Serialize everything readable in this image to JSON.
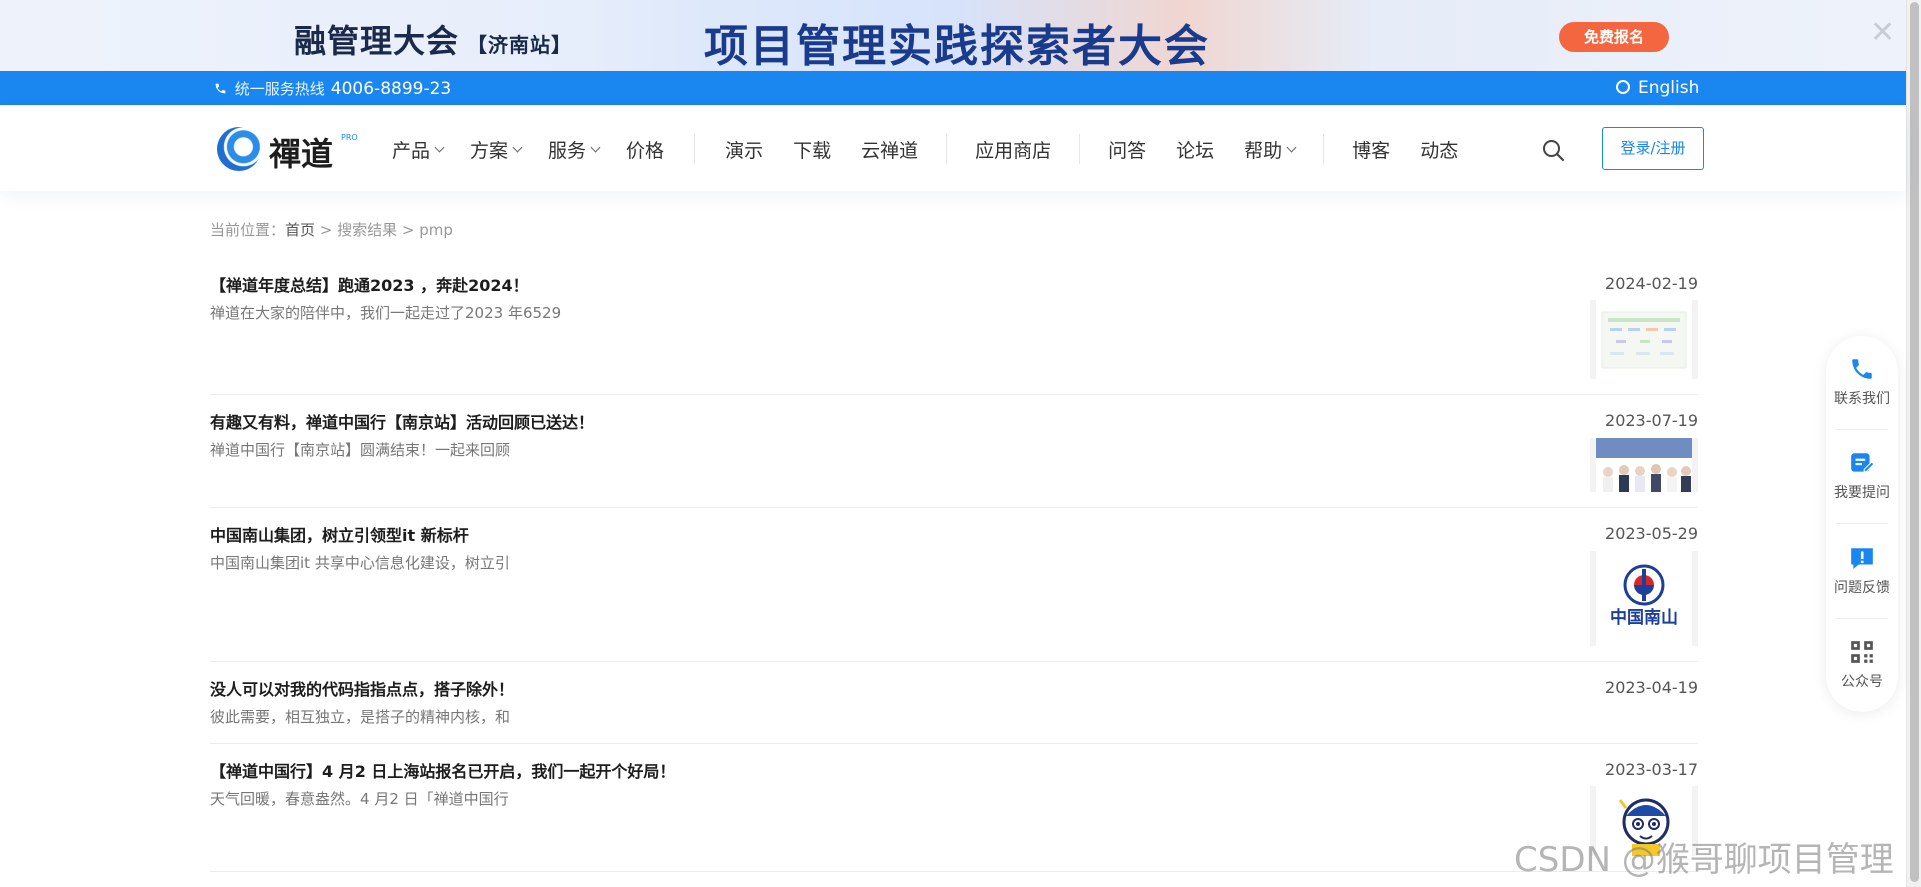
{
  "banner": {
    "left_title": "融管理大会",
    "left_tag": "【济南站】",
    "main_title": "项目管理实践探索者大会",
    "signup_label": "免费报名",
    "close_glyph": "✕"
  },
  "topbar": {
    "hotline_label": "统一服务热线",
    "hotline_number": "4006-8899-23",
    "language": "English"
  },
  "nav": {
    "logo_text": "禪道",
    "logo_tm": "PRO",
    "menu": [
      {
        "label": "产品",
        "dropdown": true
      },
      {
        "label": "方案",
        "dropdown": true
      },
      {
        "label": "服务",
        "dropdown": true
      },
      {
        "label": "价格",
        "dropdown": false
      },
      {
        "label": "演示",
        "dropdown": false
      },
      {
        "label": "下载",
        "dropdown": false
      },
      {
        "label": "云禅道",
        "dropdown": false
      },
      {
        "label": "应用商店",
        "dropdown": false
      },
      {
        "label": "问答",
        "dropdown": false
      },
      {
        "label": "论坛",
        "dropdown": false
      },
      {
        "label": "帮助",
        "dropdown": true
      },
      {
        "label": "博客",
        "dropdown": false
      },
      {
        "label": "动态",
        "dropdown": false
      }
    ],
    "login_label": "登录/注册"
  },
  "breadcrumb": {
    "prefix": "当前位置：",
    "home": "首页",
    "sep1": " > ",
    "search": "搜索结果",
    "sep2": " > ",
    "query": "pmp"
  },
  "results": [
    {
      "title": "【禅道年度总结】跑通2023 ，奔赴2024！",
      "desc": "禅道在大家的陪伴中，我们一起走过了2023 年6529",
      "date": "2024-02-19",
      "thumb": "chart"
    },
    {
      "title": "有趣又有料，禅道中国行【南京站】活动回顾已送达！",
      "desc": "禅道中国行【南京站】圆满结束！一起来回顾",
      "date": "2023-07-19",
      "thumb": "photo"
    },
    {
      "title": "中国南山集团，树立引领型it 新标杆",
      "desc": "中国南山集团it 共享中心信息化建设，树立引",
      "date": "2023-05-29",
      "thumb": "logo",
      "thumb_text": "中国南山"
    },
    {
      "title": "没人可以对我的代码指指点点，搭子除外！",
      "desc": "彼此需要，相互独立，是搭子的精神内核，和",
      "date": "2023-04-19",
      "thumb": "none"
    },
    {
      "title": "【禅道中国行】4 月2 日上海站报名已开启，我们一起开个好局！",
      "desc": "天气回暖，春意盎然。4 月2 日「禅道中国行",
      "date": "2023-03-17",
      "thumb": "cartoon"
    }
  ],
  "sidepanel": {
    "contact": "联系我们",
    "ask": "我要提问",
    "feedback": "问题反馈",
    "wechat": "公众号"
  },
  "watermark": "CSDN @猴哥聊项目管理",
  "colors": {
    "brand_blue": "#1a86f0",
    "signup_orange": "#f3663f"
  }
}
